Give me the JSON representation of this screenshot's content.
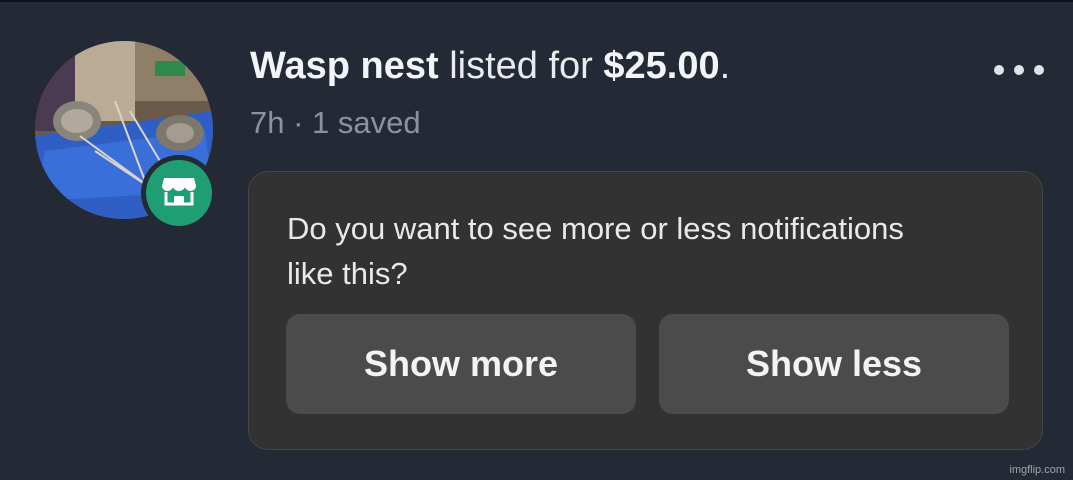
{
  "notification": {
    "item_name": "Wasp nest",
    "listed_text": " listed for ",
    "price": "$25.00",
    "period": ".",
    "time_ago": "7h",
    "separator": " · ",
    "saved_count": "1 saved",
    "more_options_icon": "more-horizontal-icon",
    "badge_icon": "marketplace-storefront-icon",
    "badge_color": "#1f9e74"
  },
  "feedback": {
    "question": "Do you want to see more or less notifications like this?",
    "show_more_label": "Show more",
    "show_less_label": "Show less"
  },
  "watermark": "imgflip.com"
}
